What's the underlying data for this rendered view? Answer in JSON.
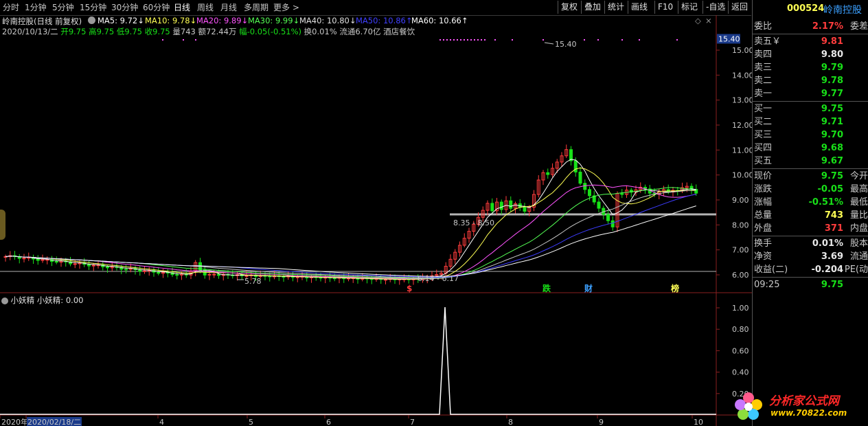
{
  "toolbar": {
    "periods": [
      "分时",
      "1分钟",
      "5分钟",
      "15分钟",
      "30分钟",
      "60分钟",
      "日线",
      "周线",
      "月线",
      "多周期",
      "更多 >"
    ],
    "active_period": "日线",
    "right_buttons": [
      "复权",
      "叠加",
      "统计",
      "画线",
      "F10",
      "标记",
      "-自选",
      "返回"
    ]
  },
  "ma_bar": {
    "stock_label": "岭南控股(日线 前复权)",
    "ma5": "MA5: 9.72↓",
    "ma10": "MA10: 9.78↓",
    "ma20": "MA20: 9.89↓",
    "ma30": "MA30: 9.99↓",
    "ma40": "MA40: 10.80↓",
    "ma50": "MA50: 10.86↑",
    "ma60": "MA60: 10.66↑"
  },
  "info_line": {
    "date": "2020/10/13/二",
    "open": "开9.75",
    "high": "高9.75",
    "low": "低9.75",
    "close": "收9.75",
    "volume": "量743",
    "amount": "额72.44万",
    "change": "幅-0.05(-0.51%)",
    "turnover": "换0.01%",
    "float": "流通6.70亿",
    "industry": "酒店餐饮"
  },
  "chart_data": {
    "type": "candlestick",
    "y_axis_labels": [
      "15.40",
      "15.00",
      "14.00",
      "13.00",
      "12.00",
      "11.00",
      "10.00",
      "9.00",
      "8.00",
      "7.00",
      "6.00"
    ],
    "ylim": [
      5.9,
      15.6
    ],
    "annotations": [
      "15.40",
      "8.35 - 8.50",
      "6.14 - 6.17",
      "5.78"
    ],
    "signal_labels": [
      "$",
      "跌",
      "财",
      "榜"
    ],
    "x_labels": [
      "2020年",
      "2020/02/18/二",
      "4",
      "5",
      "6",
      "7",
      "8",
      "9",
      "10"
    ],
    "indicator": {
      "name": "小妖精",
      "value_label": "小妖精: 0.00",
      "y_axis_labels": [
        "1.00",
        "0.80",
        "0.60",
        "0.40",
        "0.20"
      ],
      "ylim": [
        0,
        1.05
      ],
      "series": [
        0,
        0,
        0,
        0,
        0,
        1,
        0,
        0,
        0,
        0
      ]
    }
  },
  "quote": {
    "code": "000524",
    "name": "岭南控股",
    "weibi_label": "委比",
    "weibi_value": "2.17%",
    "weicha_label": "委差",
    "sell": [
      {
        "label": "卖五￥",
        "price": "9.81"
      },
      {
        "label": "卖四",
        "price": "9.80"
      },
      {
        "label": "卖三",
        "price": "9.79"
      },
      {
        "label": "卖二",
        "price": "9.78"
      },
      {
        "label": "卖一",
        "price": "9.77"
      }
    ],
    "buy": [
      {
        "label": "买一",
        "price": "9.75"
      },
      {
        "label": "买二",
        "price": "9.71"
      },
      {
        "label": "买三",
        "price": "9.70"
      },
      {
        "label": "买四",
        "price": "9.68"
      },
      {
        "label": "买五",
        "price": "9.67"
      }
    ],
    "stats": [
      {
        "label": "现价",
        "value": "9.75",
        "extra": "今开"
      },
      {
        "label": "涨跌",
        "value": "-0.05",
        "extra": "最高"
      },
      {
        "label": "涨幅",
        "value": "-0.51%",
        "extra": "最低"
      },
      {
        "label": "总量",
        "value": "743",
        "extra": "量比"
      },
      {
        "label": "外盘",
        "value": "371",
        "extra": "内盘"
      },
      {
        "label": "换手",
        "value": "0.01%",
        "extra": "股本"
      },
      {
        "label": "净资",
        "value": "3.69",
        "extra": "流通"
      },
      {
        "label": "收益(二)",
        "value": "-0.204",
        "extra": "PE(动"
      }
    ],
    "time": "09:25",
    "time_price": "9.75"
  },
  "watermark": {
    "line1": "分析家公式网",
    "line2": "www.70822.com"
  },
  "colors": {
    "up": "#ff3c3c",
    "down": "#18e018",
    "ma5": "#ffffff",
    "ma10": "#ffff54",
    "ma20": "#ff54ff",
    "ma30": "#54ff54",
    "ma40": "#c8c8c8",
    "ma50": "#3c3cff",
    "ma60": "#ffffff"
  }
}
